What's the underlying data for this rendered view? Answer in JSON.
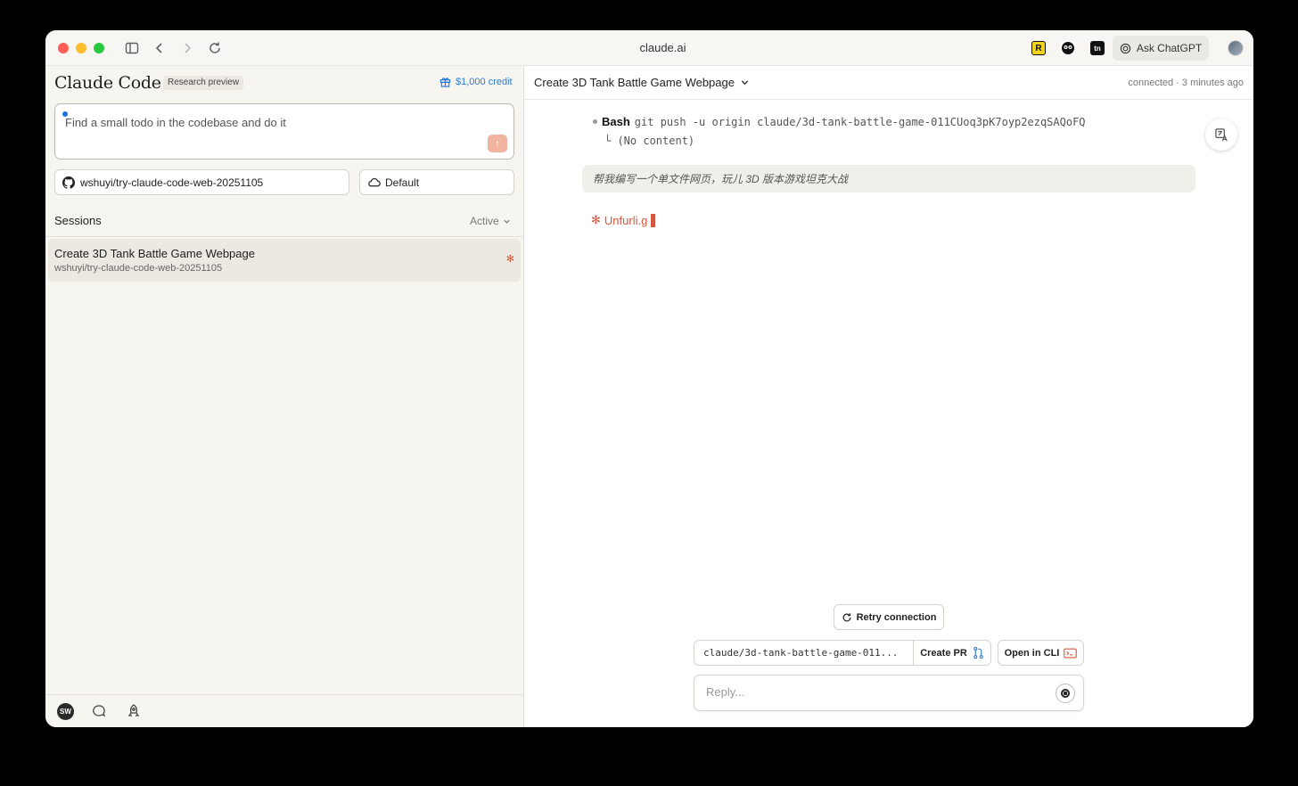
{
  "browser": {
    "url": "claude.ai",
    "extensions": [
      "R",
      "",
      "tn"
    ],
    "ask_chatgpt_label": "Ask ChatGPT"
  },
  "sidebar": {
    "brand": "Claude Code",
    "badge": "Research preview",
    "credit": "$1,000 credit",
    "prompt": "Find a small todo in the codebase and do it",
    "send_icon": "↑",
    "repo": "wshuyi/try-claude-code-web-20251105",
    "environment": "Default",
    "sessions_title": "Sessions",
    "sessions_filter": "Active",
    "sessions": [
      {
        "title": "Create 3D Tank Battle Game Webpage",
        "repo": "wshuyi/try-claude-code-web-20251105",
        "status_icon": "✻"
      }
    ],
    "avatar_initials": "SW"
  },
  "chat": {
    "title": "Create 3D Tank Battle Game Webpage",
    "connection": "connected · 3 minutes ago",
    "bash_label": "Bash",
    "bash_command": "git push -u origin claude/3d-tank-battle-game-011CUoq3pK7oyp2ezqSAQoFQ",
    "bash_output": "└ (No content)",
    "user_message": "帮我编写一个单文件网页，玩儿 3D 版本游戏坦克大战",
    "status_icon": "✻",
    "status_text": "Unfurli.g",
    "retry_label": "Retry connection",
    "branch": "claude/3d-tank-battle-game-011...",
    "create_pr_label": "Create PR",
    "open_cli_label": "Open in CLI",
    "reply_placeholder": "Reply..."
  },
  "colors": {
    "accent": "#d3583f",
    "link": "#2f7bd6",
    "sidebar_bg": "#f7f5f0"
  }
}
